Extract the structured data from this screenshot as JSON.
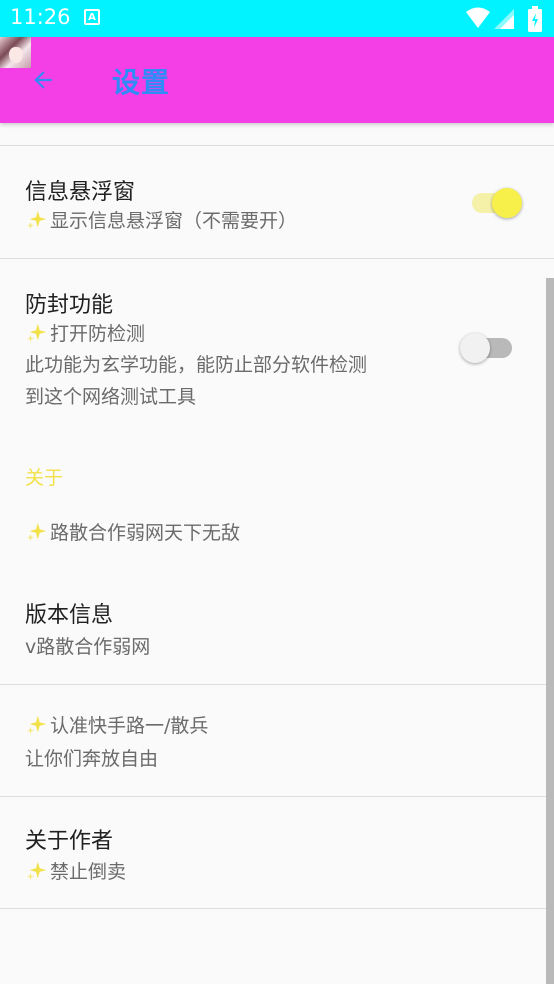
{
  "status_bar": {
    "time": "11:26",
    "notification_letter": "A"
  },
  "app_bar": {
    "title": "设置",
    "background": "#f43ee6",
    "title_color": "#2f8bf5"
  },
  "settings": {
    "floating_window": {
      "title": "信息悬浮窗",
      "subtitle": "显示信息悬浮窗（不需要开）",
      "enabled": true
    },
    "anti_block": {
      "title": "防封功能",
      "subtitle": "打开防检测",
      "description_line1": "此功能为玄学功能，能防止部分软件检测",
      "description_line2": "到这个网络测试工具",
      "enabled": false
    }
  },
  "about": {
    "section_label": "关于",
    "tagline": "路散合作弱网天下无敌",
    "version": {
      "title": "版本信息",
      "value": "v路散合作弱网"
    },
    "notice": {
      "line1": "认准快手路一/散兵",
      "line2": "让你们奔放自由"
    },
    "author": {
      "title": "关于作者",
      "subtitle": "禁止倒卖"
    }
  },
  "colors": {
    "status_bar": "#00f3ff",
    "accent_yellow": "#f3e14a",
    "switch_on_thumb": "#f7f04a",
    "switch_off_thumb": "#f1f1f1"
  }
}
